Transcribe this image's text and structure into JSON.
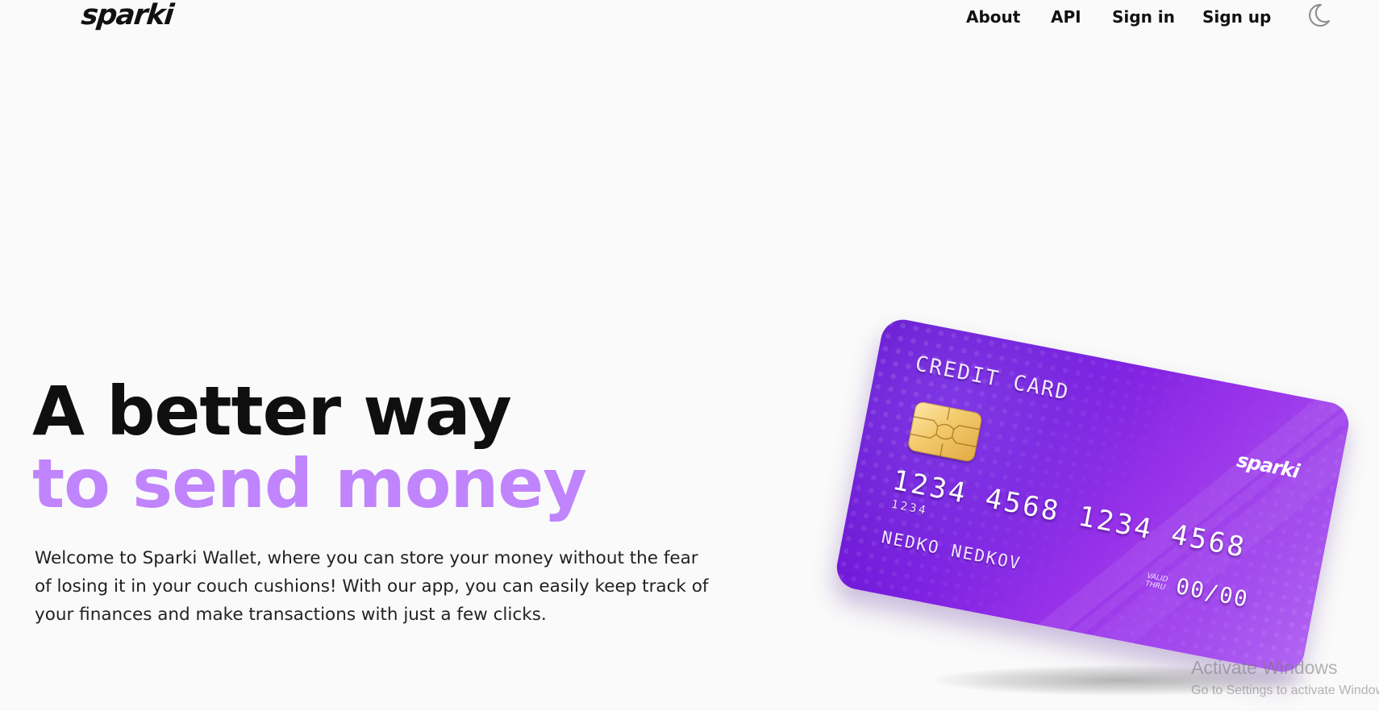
{
  "header": {
    "logo": "sparki",
    "nav": {
      "about": "About",
      "api": "API",
      "sign_in": "Sign in",
      "sign_up": "Sign up"
    },
    "theme_toggle_icon": "moon-icon"
  },
  "hero": {
    "headline_line1": "A better way",
    "headline_line2": "to send money",
    "accent_color": "#c084fc",
    "description": "Welcome to Sparki Wallet, where you can store your money without the fear of losing it in your couch cushions! With our app, you can easily keep track of your finances and make transactions with just a few clicks."
  },
  "card": {
    "title": "CREDIT CARD",
    "brand": "sparki",
    "number": "1234 4568 1234 4568",
    "number_small": "1234",
    "valid_thru_label": "VALID THRU",
    "expiry": "00/00",
    "holder": "NEDKO NEDKOV",
    "color": "#7a1ee0"
  },
  "os_watermark": {
    "title": "Activate Windows",
    "subtitle": "Go to Settings to activate Windows."
  }
}
